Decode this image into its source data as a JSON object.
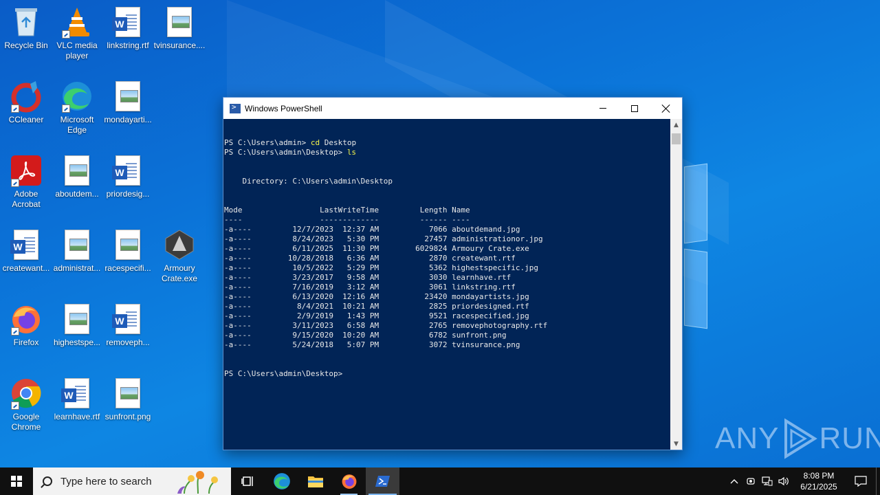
{
  "desktop": {
    "icons": [
      {
        "label": "Recycle Bin",
        "icon": "recycle-bin-icon"
      },
      {
        "label": "VLC media player",
        "icon": "vlc-icon"
      },
      {
        "label": "linkstring.rtf",
        "icon": "word-document-icon"
      },
      {
        "label": "tvinsurance....",
        "icon": "image-file-icon"
      },
      {
        "label": "CCleaner",
        "icon": "ccleaner-icon"
      },
      {
        "label": "Microsoft Edge",
        "icon": "edge-icon"
      },
      {
        "label": "mondayarti...",
        "icon": "image-file-icon"
      },
      {
        "label": "Adobe Acrobat",
        "icon": "acrobat-icon"
      },
      {
        "label": "aboutdem...",
        "icon": "image-file-icon"
      },
      {
        "label": "priordesig...",
        "icon": "word-document-icon"
      },
      {
        "label": "createwant...",
        "icon": "word-document-icon"
      },
      {
        "label": "administrat...",
        "icon": "image-file-icon"
      },
      {
        "label": "racespecifi...",
        "icon": "image-file-icon"
      },
      {
        "label": "Armoury Crate.exe",
        "icon": "armoury-crate-icon"
      },
      {
        "label": "Firefox",
        "icon": "firefox-icon"
      },
      {
        "label": "highestspe...",
        "icon": "image-file-icon"
      },
      {
        "label": "removeph...",
        "icon": "word-document-icon"
      },
      {
        "label": "Google Chrome",
        "icon": "chrome-icon"
      },
      {
        "label": "learnhave.rtf",
        "icon": "word-document-icon"
      },
      {
        "label": "sunfront.png",
        "icon": "image-file-icon"
      }
    ]
  },
  "window": {
    "title": "Windows PowerShell",
    "console": {
      "prompt1": "PS C:\\Users\\admin> ",
      "cmd1": "cd",
      "arg1": " Desktop",
      "prompt2": "PS C:\\Users\\admin\\Desktop> ",
      "cmd2": "ls",
      "directory_line": "    Directory: C:\\Users\\admin\\Desktop",
      "header": "Mode                 LastWriteTime         Length Name",
      "underline": "----                 -------------         ------ ----",
      "rows": [
        "-a----         12/7/2023  12:37 AM           7066 aboutdemand.jpg",
        "-a----         8/24/2023   5:30 PM          27457 administrationor.jpg",
        "-a----         6/11/2025  11:30 PM        6029824 Armoury Crate.exe",
        "-a----        10/28/2018   6:36 AM           2870 createwant.rtf",
        "-a----         10/5/2022   5:29 PM           5362 highestspecific.jpg",
        "-a----         3/23/2017   9:58 AM           3030 learnhave.rtf",
        "-a----         7/16/2019   3:12 AM           3061 linkstring.rtf",
        "-a----         6/13/2020  12:16 AM          23420 mondayartists.jpg",
        "-a----          8/4/2021  10:21 AM           2825 priordesigned.rtf",
        "-a----          2/9/2019   1:43 PM           9521 racespecified.jpg",
        "-a----         3/11/2023   6:58 AM           2765 removephotography.rtf",
        "-a----         9/15/2020  10:20 AM           6782 sunfront.png",
        "-a----         5/24/2018   5:07 PM           3072 tvinsurance.png"
      ],
      "final_prompt": "PS C:\\Users\\admin\\Desktop>"
    }
  },
  "watermark": {
    "left": "ANY",
    "right": "RUN"
  },
  "taskbar": {
    "search_placeholder": "Type here to search",
    "apps": [
      {
        "name": "task-view",
        "icon": "task-view-icon"
      },
      {
        "name": "edge",
        "icon": "edge-icon"
      },
      {
        "name": "file-explorer",
        "icon": "folder-icon"
      },
      {
        "name": "firefox",
        "icon": "firefox-icon"
      },
      {
        "name": "powershell",
        "icon": "powershell-icon"
      }
    ],
    "clock": {
      "time": "8:08 PM",
      "date": "6/21/2025"
    }
  },
  "colors": {
    "console_bg": "#012456",
    "console_cmd": "#f4f44a",
    "desktop": "#0b73d8",
    "taskbar": "#101010"
  }
}
